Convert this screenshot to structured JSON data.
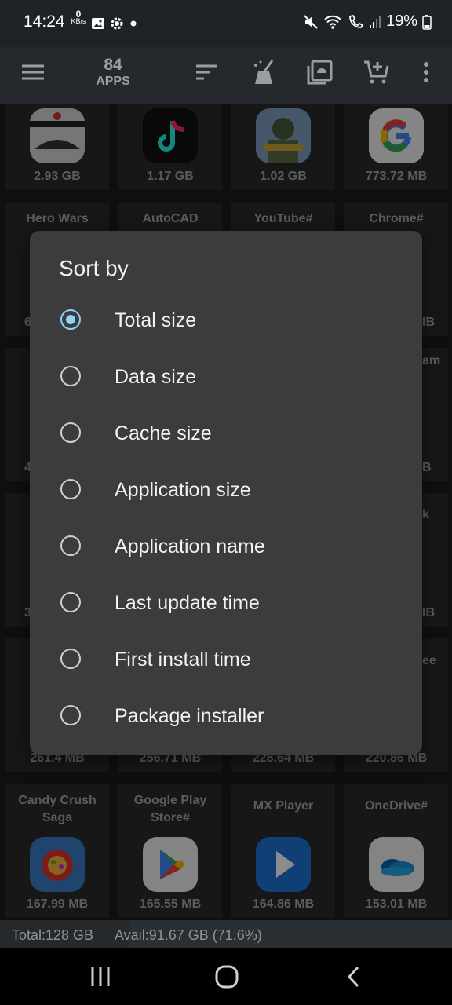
{
  "status_bar": {
    "time": "14:24",
    "net_speed_value": "0",
    "net_speed_unit": "KB/s",
    "battery": "19%"
  },
  "toolbar": {
    "count": "84",
    "count_label": "APPS"
  },
  "app_tiles": [
    {
      "name": "",
      "size": "2.93 GB"
    },
    {
      "name": "",
      "size": "1.17 GB"
    },
    {
      "name": "",
      "size": "1.02 GB"
    },
    {
      "name": "",
      "size": "773.72 MB"
    },
    {
      "name": "Hero Wars",
      "size": ""
    },
    {
      "name": "AutoCAD",
      "size": ""
    },
    {
      "name": "YouTube#",
      "size": ""
    },
    {
      "name": "Chrome#",
      "size": ""
    },
    {
      "name": "",
      "size": "261.4 MB"
    },
    {
      "name": "",
      "size": "256.71 MB"
    },
    {
      "name": "",
      "size": "228.64 MB"
    },
    {
      "name": "",
      "size": "220.86 MB"
    },
    {
      "name": "Candy Crush Saga",
      "size": "167.99 MB"
    },
    {
      "name": "Google Play Store#",
      "size": "165.55 MB"
    },
    {
      "name": "MX Player",
      "size": "164.86 MB"
    },
    {
      "name": "OneDrive#",
      "size": "153.01 MB"
    }
  ],
  "edge_fragments": {
    "l1": "6",
    "r1": "IB",
    "r2": "am",
    "l2": "4",
    "r3": "B",
    "r4": "k",
    "l3": "3",
    "r5": "IB",
    "r6": "ee"
  },
  "dialog": {
    "title": "Sort by",
    "options": [
      {
        "label": "Total size",
        "selected": true
      },
      {
        "label": "Data size",
        "selected": false
      },
      {
        "label": "Cache size",
        "selected": false
      },
      {
        "label": "Application size",
        "selected": false
      },
      {
        "label": "Application name",
        "selected": false
      },
      {
        "label": "Last update time",
        "selected": false
      },
      {
        "label": "First install time",
        "selected": false
      },
      {
        "label": "Package installer",
        "selected": false
      }
    ]
  },
  "footer": {
    "total": "Total:128 GB",
    "avail": "Avail:91.67 GB (71.6%)"
  },
  "colors": {
    "accent": "#8fd0f6",
    "dialog_bg": "#3c3c3d",
    "tile_bg": "#2a2b2c"
  }
}
